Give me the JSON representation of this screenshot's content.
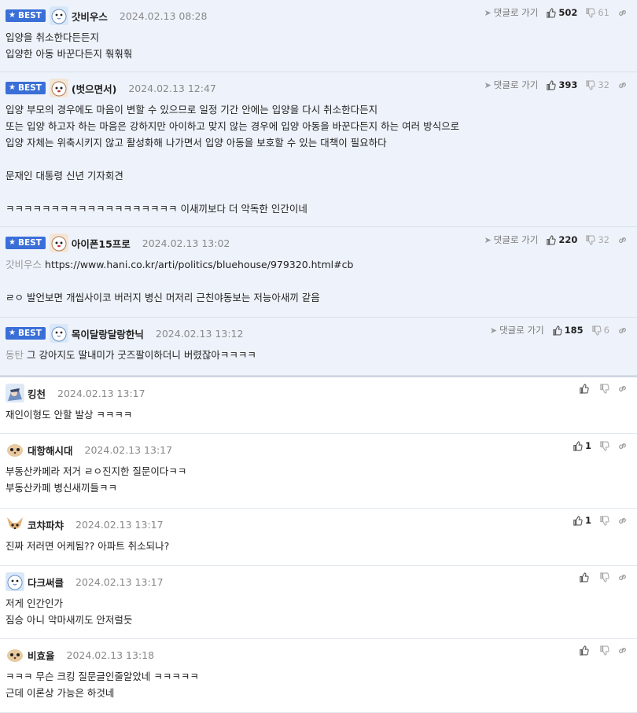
{
  "comments": [
    {
      "best": true,
      "badge": "BEST",
      "avatar": "penguin",
      "nick": "갓비우스",
      "time": "2024.02.13 08:28",
      "reply_label": "댓글로 가기",
      "up": "502",
      "down": "61",
      "reply_to": "",
      "text": "입양을 취소한다든든지\n입양한 아동 바꾼다든지 훢훢훢"
    },
    {
      "best": true,
      "badge": "BEST",
      "avatar": "dog",
      "nick": "(벗으면서)",
      "time": "2024.02.13 12:47",
      "reply_label": "댓글로 가기",
      "up": "393",
      "down": "32",
      "reply_to": "",
      "text": "입양 부모의 경우에도 마음이 변할 수 있으므로 일정 기간 안에는 입양을 다시 취소한다든지\n또는 입양 하고자 하는 마음은 강하지만 아이하고 맞지 않는 경우에 입양 아동을 바꾼다든지 하는 여러 방식으로\n입양 자체는 위축시키지 않고 활성화해 나가면서 입양 아동을 보호할 수 있는 대책이 필요하다\n\n문재인 대통령 신년 기자회견\n\nㅋㅋㅋㅋㅋㅋㅋㅋㅋㅋㅋㅋㅋㅋㅋㅋㅋㅋㅋ 이새끼보다 더 악독한 인간이네"
    },
    {
      "best": true,
      "badge": "BEST",
      "avatar": "dog",
      "nick": "아이폰15프로",
      "time": "2024.02.13 13:02",
      "reply_label": "댓글로 가기",
      "up": "220",
      "down": "32",
      "reply_to": "갓비우스",
      "text": "https://www.hani.co.kr/arti/politics/bluehouse/979320.html#cb\n\nㄹㅇ 발언보면 개씹사이코 버러지 병신 머저리 근친야동보는 저능아새끼 같음"
    },
    {
      "best": true,
      "badge": "BEST",
      "avatar": "penguin",
      "nick": "목이달랑달랑한닉",
      "time": "2024.02.13 13:12",
      "reply_label": "댓글로 가기",
      "up": "185",
      "down": "6",
      "reply_to": "동탄",
      "text": "그 강아지도 딸내미가 굿즈팔이하더니 버렸잖아ㅋㅋㅋㅋ"
    },
    {
      "best": false,
      "avatar": "chara",
      "nick": "킹천",
      "time": "2024.02.13 13:17",
      "up": "",
      "down": "",
      "reply_to": "",
      "text": "재인이형도 안할 발상 ㅋㅋㅋㅋ"
    },
    {
      "best": false,
      "avatar": "meerkat",
      "nick": "대항해시대",
      "time": "2024.02.13 13:17",
      "up": "1",
      "down": "",
      "reply_to": "",
      "text": "부동산카페라 저거 ㄹㅇ진지한 질문이다ㅋㅋ\n부동산카페 병신새끼들ㅋㅋ"
    },
    {
      "best": false,
      "avatar": "chihuahua",
      "nick": "코챠파챠",
      "time": "2024.02.13 13:17",
      "up": "1",
      "down": "",
      "reply_to": "",
      "text": "진짜 저러면 어케됨?? 아파트 취소되나?"
    },
    {
      "best": false,
      "avatar": "penguin",
      "nick": "다크써클",
      "time": "2024.02.13 13:17",
      "up": "",
      "down": "",
      "reply_to": "",
      "text": "저게 인간인가\n짐승 아니 악마새끼도 안저럴듯"
    },
    {
      "best": false,
      "avatar": "meerkat",
      "nick": "비효율",
      "time": "2024.02.13 13:18",
      "up": "",
      "down": "",
      "reply_to": "",
      "text": "ㅋㅋㅋ 무슨 크킹 질문글인줄알았네 ㅋㅋㅋㅋㅋ\n근데 이론상 가능은 하것네"
    }
  ],
  "colors": {
    "best_bg": "#eef3fb",
    "badge": "#3a6fd8",
    "border": "#e3e7ee"
  }
}
